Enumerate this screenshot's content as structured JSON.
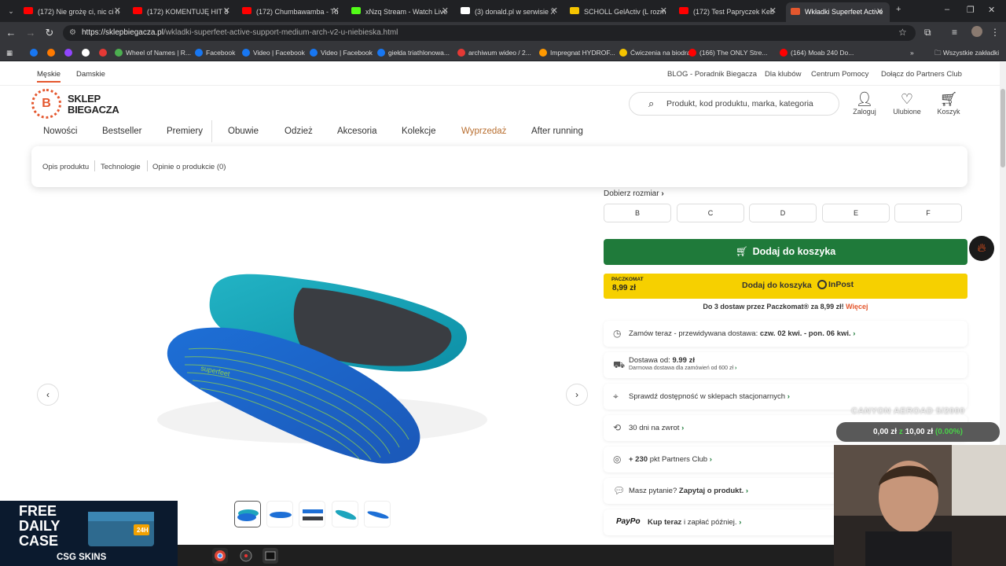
{
  "browser": {
    "tabs": [
      {
        "title": "(172) Nie grożę ci, nic ci n",
        "icon": "youtube-icon",
        "color": "#ff0000"
      },
      {
        "title": "(172) KOMENTUJĘ HIT 3 L",
        "icon": "youtube-icon",
        "color": "#ff0000"
      },
      {
        "title": "(172) Chumbawamba - Tu",
        "icon": "youtube-icon",
        "color": "#ff0000"
      },
      {
        "title": "xNzq Stream - Watch Live",
        "icon": "kick-icon",
        "color": "#53fc18"
      },
      {
        "title": "(3) donald.pl w serwisie X",
        "icon": "x-icon",
        "color": "#ffffff"
      },
      {
        "title": "SCHOLL GelActiv (L rozm",
        "icon": "scholl-icon",
        "color": "#f5c400"
      },
      {
        "title": "(172) Test Papryczek Keb",
        "icon": "youtube-icon",
        "color": "#ff0000"
      },
      {
        "title": "Wkładki Superfeet Active",
        "icon": "shop-icon",
        "color": "#e4572e"
      }
    ],
    "url_domain": "https://sklepbiegacza.pl",
    "url_path": "/wkladki-superfeet-active-support-medium-arch-v2-u-niebieska.html",
    "bookmarks": [
      {
        "label": "",
        "color": "#1877f2"
      },
      {
        "label": "",
        "color": "#ff7a00"
      },
      {
        "label": "",
        "color": "#9146ff"
      },
      {
        "label": "",
        "color": "#ffffff"
      },
      {
        "label": "",
        "color": "#e53935"
      },
      {
        "label": "Wheel of Names | R...",
        "color": "#4caf50"
      },
      {
        "label": "Facebook",
        "color": "#1877f2"
      },
      {
        "label": "Video | Facebook",
        "color": "#1877f2"
      },
      {
        "label": "Video | Facebook",
        "color": "#1877f2"
      },
      {
        "label": "giełda triathlonowa...",
        "color": "#1877f2"
      },
      {
        "label": "archiwum wideo / 2...",
        "color": "#e53935"
      },
      {
        "label": "Impregnat HYDROF...",
        "color": "#ff9900"
      },
      {
        "label": "Ćwiczenia na biodra...",
        "color": "#f5c400"
      },
      {
        "label": "(166) The ONLY Stre...",
        "color": "#ff0000"
      },
      {
        "label": "(164) Moab 240 Do...",
        "color": "#ff0000"
      }
    ],
    "all_bookmarks": "Wszystkie zakładki"
  },
  "site": {
    "gender_tabs": [
      "Męskie",
      "Damskie"
    ],
    "top_links": [
      "BLOG - Poradnik Biegacza",
      "Dla klubów",
      "Centrum Pomocy",
      "Dołącz do Partners Club"
    ],
    "logo_line1": "SKLEP",
    "logo_line2": "BIEGACZA",
    "search_placeholder": "Produkt, kod produktu, marka, kategoria",
    "user_icons": [
      "Zaloguj",
      "Ulubione",
      "Koszyk"
    ],
    "nav": [
      "Nowości",
      "Bestseller",
      "Premiery",
      "Obuwie",
      "Odzież",
      "Akcesoria",
      "Kolekcje",
      "Wyprzedaż",
      "After running"
    ]
  },
  "product": {
    "subnav": [
      "Opis produktu",
      "Technologie",
      "Opinie o produkcie (0)"
    ],
    "size_picker": "Dobierz rozmiar",
    "sizes": [
      "B",
      "C",
      "D",
      "E",
      "F"
    ],
    "add_to_cart": "Dodaj do koszyka",
    "inpost_label": "PACZKOMAT",
    "inpost_price": "8,99 zł",
    "inpost_text": "Dodaj do koszyka",
    "inpost_brand": "InPost",
    "paczkomat_note": "Do 3 dostaw przez Paczkomat® za 8,99 zł!",
    "paczkomat_link": "Więcej",
    "info_rows": [
      {
        "icon": "clock-icon",
        "text": "Zamów teraz - przewidywana dostawa:",
        "bold": "czw. 02 kwi. - pon. 06 kwi."
      },
      {
        "icon": "truck-icon",
        "text": "Dostawa od:",
        "bold": "9.99 zł",
        "small": "Darmowa dostawa dla zamówień od 600 zł"
      },
      {
        "icon": "location-icon",
        "text": "Sprawdź dostępność w sklepach stacjonarnych",
        "bold": ""
      },
      {
        "icon": "return-icon",
        "text": "30 dni na zwrot",
        "bold": ""
      },
      {
        "icon": "club-icon",
        "text": "pkt Partners Club",
        "bold": "+ 230"
      },
      {
        "icon": "chat-icon",
        "text": "Masz pytanie?",
        "bold": "Zapytaj o produkt."
      },
      {
        "icon": "paypo-icon",
        "text": "i zapłać później.",
        "bold": "Kup teraz",
        "brand": "PayPo"
      }
    ]
  },
  "overlays": {
    "stream_title": "CANYON AEROAD 5/2000",
    "goal_current": "0,00 zł",
    "goal_sep": "z",
    "goal_target": "10,00 zł",
    "goal_pct": "(0.00%)",
    "ad_line1": "FREE",
    "ad_line2": "DAILY",
    "ad_line3": "CASE",
    "ad_brand": "CSG SKINS",
    "ad_badge": "24H"
  }
}
